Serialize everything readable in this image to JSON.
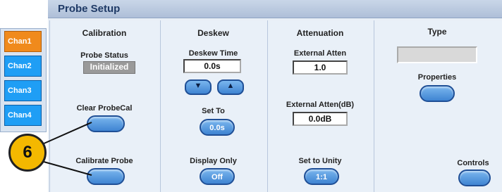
{
  "window": {
    "title": "Probe Setup"
  },
  "tabs": [
    {
      "label": "Chan1",
      "active": true
    },
    {
      "label": "Chan2",
      "active": false
    },
    {
      "label": "Chan3",
      "active": false
    },
    {
      "label": "Chan4",
      "active": false
    }
  ],
  "calibration": {
    "header": "Calibration",
    "probe_status_label": "Probe Status",
    "probe_status_value": "Initialized",
    "clear_probecal_label": "Clear ProbeCal",
    "calibrate_probe_label": "Calibrate Probe"
  },
  "deskew": {
    "header": "Deskew",
    "deskew_time_label": "Deskew Time",
    "deskew_time_value": "0.0s",
    "down_arrow": "▼",
    "up_arrow": "▲",
    "set_to_label": "Set To",
    "set_to_button": "0.0s",
    "display_only_label": "Display Only",
    "display_only_button": "Off"
  },
  "attenuation": {
    "header": "Attenuation",
    "external_atten_label": "External Atten",
    "external_atten_value": "1.0",
    "external_atten_db_label": "External Atten(dB)",
    "external_atten_db_value": "0.0dB",
    "set_to_unity_label": "Set to Unity",
    "set_to_unity_button": "1:1"
  },
  "type": {
    "header": "Type",
    "properties_label": "Properties",
    "controls_label": "Controls"
  },
  "callout": {
    "number": "6"
  },
  "colors": {
    "accent_blue": "#3f84d2",
    "active_tab": "#f08a1c",
    "callout": "#f4b800"
  }
}
